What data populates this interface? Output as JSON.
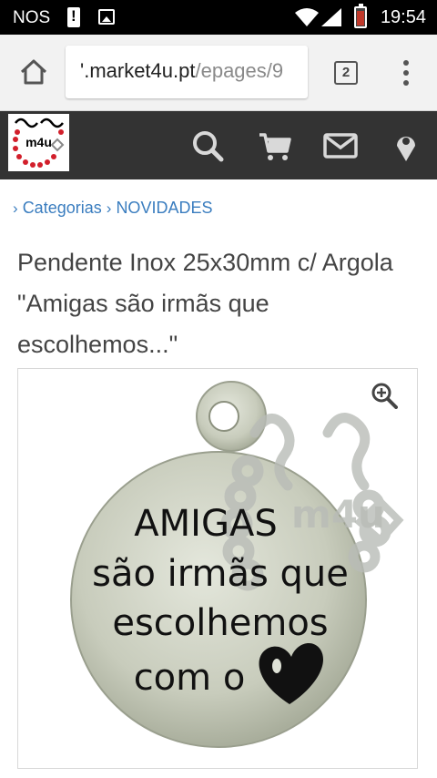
{
  "status_bar": {
    "carrier": "NOS",
    "time": "19:54"
  },
  "browser": {
    "url_domain": "'.market4u.pt",
    "url_path": "/epages/9",
    "tab_count": "2"
  },
  "site_header": {
    "logo_text": "m4u",
    "icons": [
      "search-icon",
      "cart-icon",
      "mail-icon",
      "location-pin-icon"
    ],
    "icon_color": "#d9d9d9",
    "background": "#333333"
  },
  "breadcrumb": {
    "items": [
      "Categorias",
      "NOVIDADES"
    ]
  },
  "product": {
    "title": "Pendente Inox 25x30mm c/ Argola \"Amigas são irmãs que escolhemos...\"",
    "image": {
      "watermark": "m4u",
      "lines": [
        "AMIGAS",
        "são irmãs que",
        "escolhemos",
        "com o"
      ]
    }
  },
  "colors": {
    "link": "#3a7dbf",
    "header": "#333333",
    "status_bar": "#000000"
  }
}
